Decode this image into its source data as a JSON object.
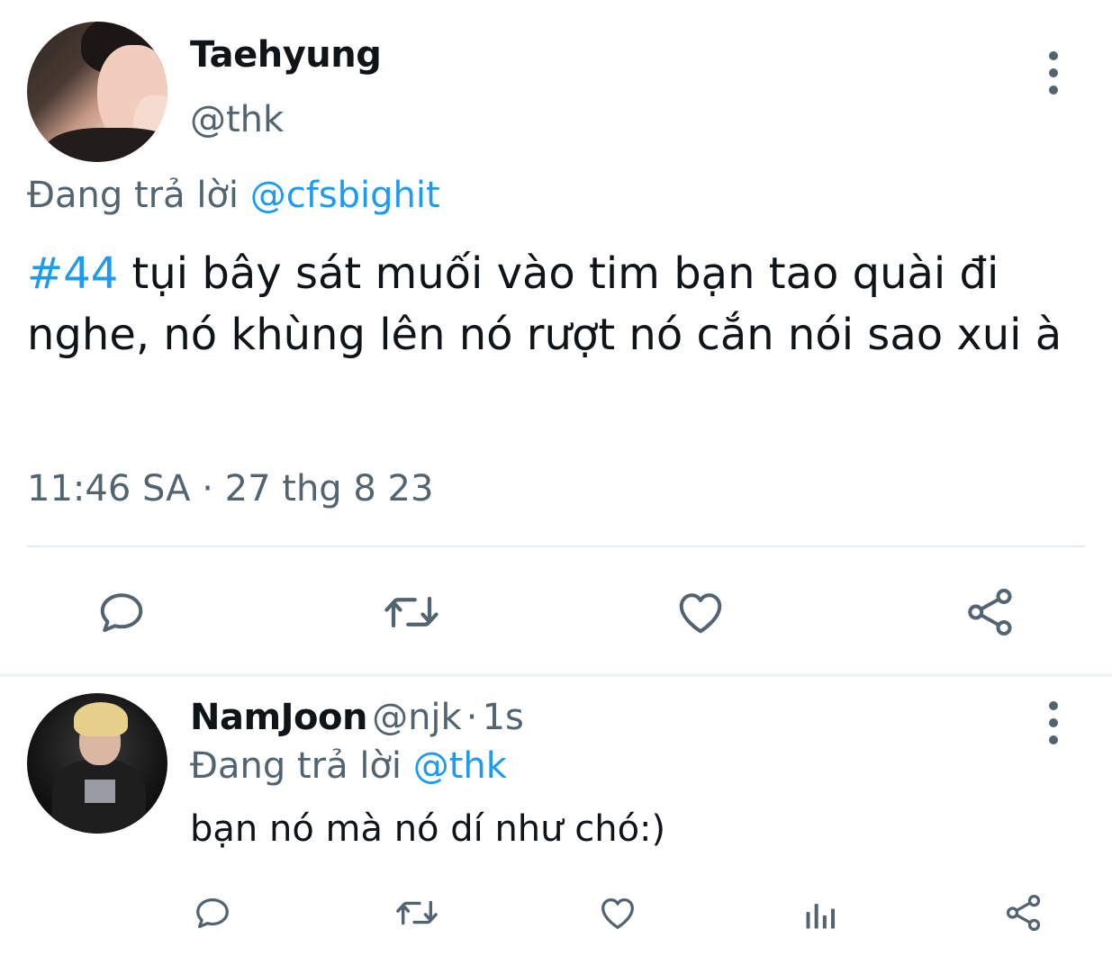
{
  "main_tweet": {
    "author": {
      "display_name": "Taehyung",
      "handle": "@thk"
    },
    "reply_prefix": "Đang trả lời",
    "reply_to": "@cfsbighit",
    "hashtag": "#44",
    "text": " tụi bây sát muối vào tim bạn tao quài đi nghe, nó khùng lên nó rượt nó cắn nói sao xui à",
    "time": "11:46 SA",
    "separator": "·",
    "date": "27 thg 8 23"
  },
  "reply_tweet": {
    "author": {
      "display_name": "NamJoon",
      "handle": "@njk",
      "separator": "·",
      "age": "1s"
    },
    "reply_prefix": "Đang trả lời",
    "reply_to": "@thk",
    "text": "bạn nó mà nó dí như chó:)"
  },
  "icons": {
    "main_actions": [
      "reply-icon",
      "retweet-icon",
      "like-icon",
      "share-icon"
    ],
    "reply_actions": [
      "reply-icon",
      "retweet-icon",
      "like-icon",
      "analytics-icon",
      "share-icon"
    ],
    "menu": "more-options-icon"
  },
  "colors": {
    "link": "#1d9bf0",
    "muted": "#536471",
    "text": "#0f1419",
    "divider": "#e6ecf0"
  }
}
